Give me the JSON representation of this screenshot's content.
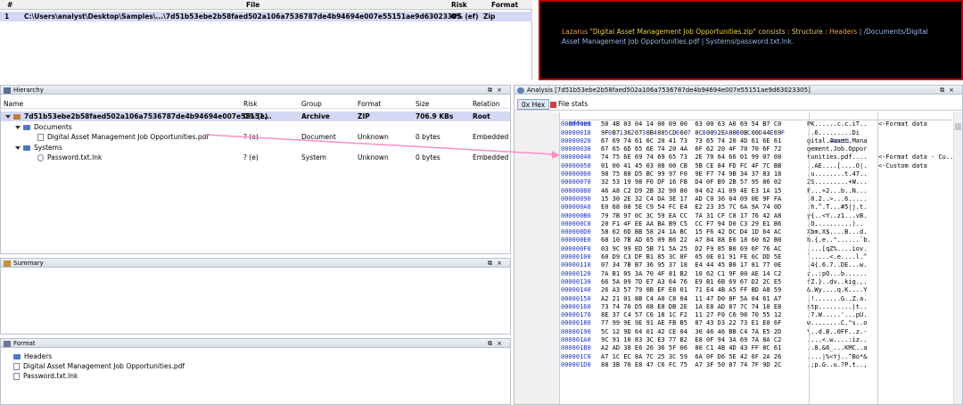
{
  "samples": {
    "headers": [
      "#",
      "File",
      "Risk",
      "Format"
    ],
    "rows": [
      [
        "1",
        "C:\\Users\\analyst\\Desktop\\Samples\\...\\7d51b53ebe2b58faed502a106a7536787de4b94694e007e55151ae9d63023305",
        "0% (ef)",
        "Zip"
      ]
    ]
  },
  "info": {
    "part1": "Lazarus ",
    "part2": "\"Digital Asset Management Job Opportunities.zip\"",
    "part3": " consists : Structure : ",
    "part4": "Headers",
    "part5": " | /Documents/Digital Asset Management Job Opportunities.pdf | Systems/password.txt.lnk."
  },
  "hierarchy": {
    "title": "Hierarchy",
    "headers": [
      "Name",
      "Risk",
      "Group",
      "Format",
      "Size",
      "Relation"
    ],
    "rows": [
      {
        "name": "7d51b53ebe2b58faed502a106a7536787de4b94694e007e55151...",
        "risk": "0% (e)",
        "group": "Archive",
        "format": "ZIP",
        "size": "706.9 KBs",
        "relation": "Root"
      },
      {
        "name": "Documents",
        "risk": "",
        "group": "",
        "format": "",
        "size": "",
        "relation": ""
      },
      {
        "name": "Digital Asset Management Job Opportunities.pdf",
        "risk": "? (e)",
        "group": "Document",
        "format": "Unknown",
        "size": "0 bytes",
        "relation": "Embedded"
      },
      {
        "name": "Systems",
        "risk": "",
        "group": "",
        "format": "",
        "size": "",
        "relation": ""
      },
      {
        "name": "Password.txt.lnk",
        "risk": "? (e)",
        "group": "System",
        "format": "Unknown",
        "size": "0 bytes",
        "relation": "Embedded"
      }
    ]
  },
  "summary": {
    "title": "Summary"
  },
  "format": {
    "title": "Format",
    "items": [
      "Headers",
      "Digital Asset Management Job Opportunities.pdf",
      "Password.txt.lnk"
    ]
  },
  "analysis": {
    "title": "Analysis [7d51b53ebe2b58faed502a106a7536787de4b94694e007e55151ae9d63023305]",
    "hex_tab": "0x Hex",
    "stats_tab": "File stats",
    "col_offset": "Offset",
    "col_hex": "0  1  2  3  4  5  6  7   8  9  A  B  C  D  E  F",
    "col_ascii": "Ascii",
    "rows": [
      [
        "00000000",
        "50 4B 03 04 14 00 09 00  63 00 63 A0 69 54 B7 C0",
        "PK......c.c.iT..",
        "<-Format data"
      ],
      [
        "00000010",
        "9F B7 36 07 0B 00 CD 60  0C 00 2E 00 0B 00 44 69",
        "..6.........Di",
        ""
      ],
      [
        "00000020",
        "67 69 74 61 6C 20 41 73  73 65 74 20 4D 61 6E 61",
        "gital.Asset.Mana",
        ""
      ],
      [
        "00000030",
        "67 65 6D 65 6E 74 20 4A  6F 62 20 4F 70 70 6F 72",
        "gement.Job.Oppor",
        ""
      ],
      [
        "00000040",
        "74 75 6E 69 74 69 65 73  2E 70 64 66 01 99 07 00",
        "tunities.pdf....",
        "<-Format data - Cu..."
      ],
      [
        "00000050",
        "01 00 41 45 03 08 00 CB  5B CE 84 FD FC 4F 7C BB",
        "..AE....[....O|.",
        "<-Custom data"
      ],
      [
        "00000060",
        "98 75 88 D5 BC 99 97 F0  9E F7 74 9B 34 37 83 18",
        ".u........t.47..",
        ""
      ],
      [
        "00000070",
        "32 53 19 98 F0 DF 16 FB  D4 0F B9 2B 57 95 86 02",
        "2S.........+W...",
        ""
      ],
      [
        "00000080",
        "46 A8 C2 D9 2B 32 90 80  04 62 A1 09 4E E3 1A 15",
        "F...+2...b..N...",
        ""
      ],
      [
        "00000090",
        "15 30 2E 32 C4 DA 3E 17  AD C0 36 04 09 0E 9F FA",
        ".0.2..>...6.....",
        ""
      ],
      [
        "000000A0",
        "E0 68 08 5E C9 54 FC E4  E2 23 35 7C 6A 9A 74 0D",
        ".h.^.T...#5|j.t.",
        ""
      ],
      [
        "000000B0",
        "79 7B 97 0C 3C 59 EA CC  7A 31 CF C8 17 76 42 A8",
        "y{..<Y..z1...vB.",
        ""
      ],
      [
        "000000C0",
        "20 F1 4F EE AA BA B9 C5  CC F7 94 D0 C3 29 E1 B6",
        ".O..........)..",
        ""
      ],
      [
        "000000D0",
        "58 62 6D BB 58 24 1A BC  15 F6 42 DC D4 1D 64 AC",
        "Xbm.X$....B...d.",
        ""
      ],
      [
        "000000E0",
        "68 10 7B AD 65 09 B6 22  A7 84 88 E6 18 60 62 B0",
        "h.{.e..\"......`b.",
        ""
      ],
      [
        "000000F0",
        "03 9C 99 ED 5B 71 5A 25  D2 F9 85 B0 69 6F 76 AC",
        "....[qZ%....iov.",
        ""
      ],
      [
        "00000100",
        "60 D9 C3 DF B1 85 3C 8F  65 0E 01 91 FE 6C DD 5E",
        "`.....<.e....l.^",
        ""
      ],
      [
        "00000110",
        "07 34 7B B7 36 95 37 18  E4 44 45 B8 17 81 77 0E",
        ".4{.6.7..DE...w.",
        ""
      ],
      [
        "00000120",
        "7A B1 05 3A 70 4F 81 B2  10 62 C1 9F 80 AE 14 C2",
        "z..:pO...b......",
        ""
      ],
      [
        "00000130",
        "66 5A 09 7D E7 A3 64 76  E9 B1 6B 69 67 D2 2C E5",
        "fZ.}..dv..kig.,.",
        ""
      ],
      [
        "00000140",
        "26 A3 57 79 0B EF E8 01  71 E4 4B A5 FF BD A8 59",
        "&.Wy....q.K....Y",
        ""
      ],
      [
        "00000150",
        "A2 21 01 8B C4 A0 C8 04  11 47 D0 8F 5A 04 61 A7",
        ".!.......G..Z.a.",
        ""
      ],
      [
        "00000160",
        "73 74 70 D5 08 E8 DB 2E  1A E8 AD 87 7C 74 10 E8",
        "stp.........|t..",
        ""
      ],
      [
        "00000170",
        "8E 37 C4 57 C6 18 1C F2  11 27 F0 C6 98 70 55 12",
        ".7.W.....'...pU.",
        ""
      ],
      [
        "00000180",
        "77 99 9E 9E 91 AE FB B5  87 43 D3 22 73 E1 E0 6F",
        "w........C.\"s..o",
        ""
      ],
      [
        "00000190",
        "5C 12 9D 64 01 42 CE 04  30 46 46 BB C4 7A E5 2D",
        "\\..d.B..0FF..z.-",
        ""
      ],
      [
        "000001A0",
        "9C 91 10 83 3C E3 77 B2  E8 0F 94 3A 69 7A 8A C2",
        "....<.w....:iz..",
        ""
      ],
      [
        "000001B0",
        "A2 AD 38 E6 26 36 5F 06  80 C1 4B 4D 43 FF 8C 61",
        "..8.&6_...KMC..a",
        ""
      ],
      [
        "000001C0",
        "A7 1C EC 8A 7C 25 3C 59  6A 0F D6 5E 42 6F 2A 26",
        "....|%<Yj..^Bo*&",
        ""
      ],
      [
        "000001D0",
        "88 3B 70 E8 47 C6 FC 75  A7 3F 50 87 74 7F 9D 2C",
        ".;p.G..u.?P.t..,",
        ""
      ]
    ]
  },
  "colors": {
    "selection": "#d4d8f4",
    "info_bg": "#000000",
    "info_border": "#c00000",
    "arrow": "#ff8cc4",
    "hex_blue": "#1b31c8"
  },
  "icons": [
    "archive-icon",
    "folder-icon",
    "pdf-file-icon",
    "lnk-file-icon",
    "pin-icon",
    "close-icon",
    "hex-icon",
    "stats-icon"
  ]
}
